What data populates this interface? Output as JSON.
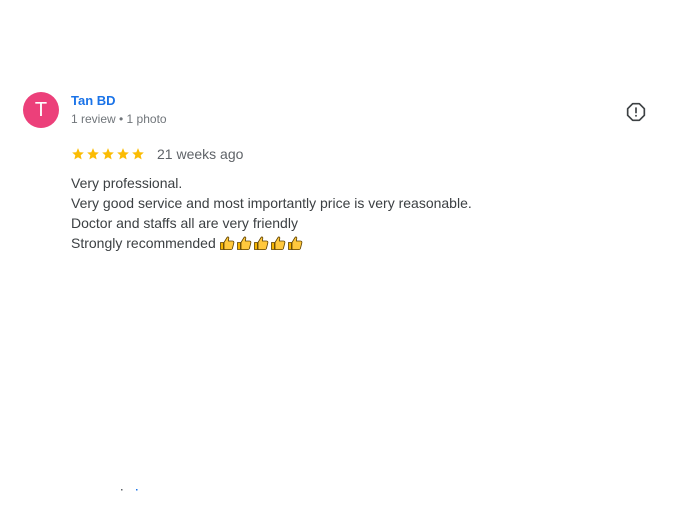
{
  "review": {
    "author_initial": "T",
    "author_name": "Tan BD",
    "author_meta": "1 review • 1 photo",
    "rating_stars": 5,
    "time_ago": "21 weeks ago",
    "text_lines": [
      "Very professional.",
      "Very good service and most importantly price is very reasonable.",
      "Doctor and staffs all are very friendly",
      "Strongly recommended"
    ],
    "emoji": "thumbs-up-icon",
    "emoji_count": 5
  },
  "colors": {
    "avatar_bg": "#ec407a",
    "author_name": "#1a73e8",
    "star": "#fbbc04",
    "meta_text": "#70757a",
    "body_text": "#3c4043"
  },
  "icons": {
    "report": "report-flag-icon",
    "star": "star-icon"
  }
}
